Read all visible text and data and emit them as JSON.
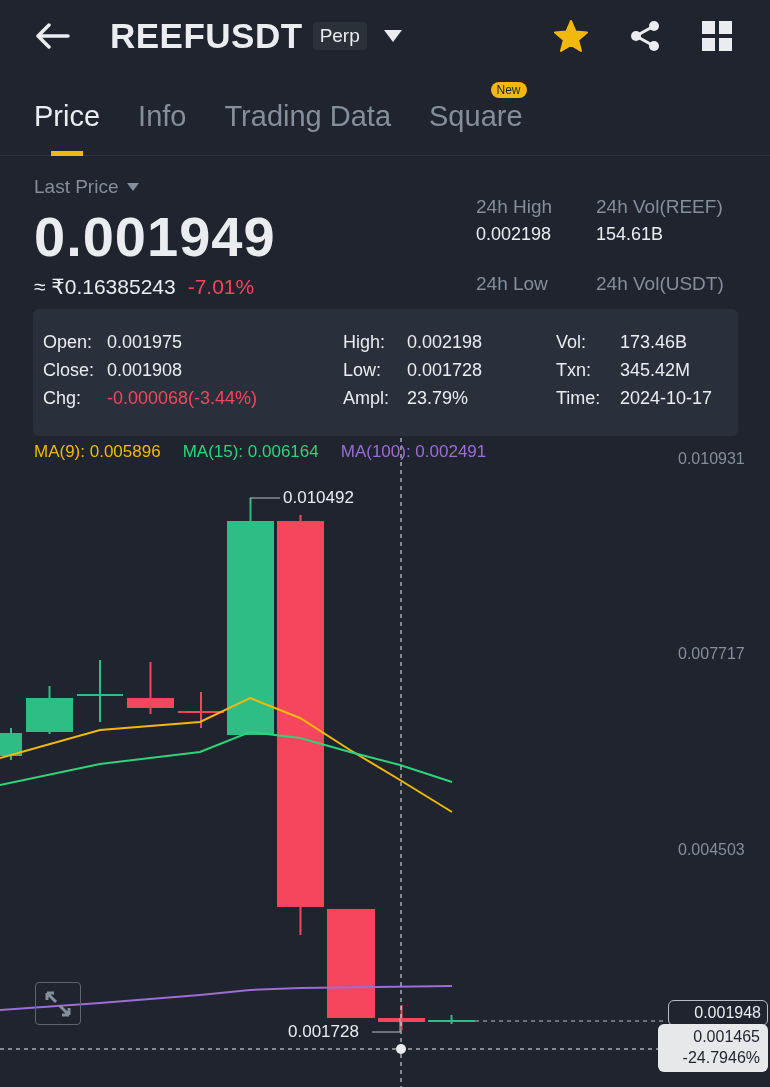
{
  "header": {
    "symbol": "REEFUSDT",
    "contract_type": "Perp",
    "favorite": true
  },
  "tabs": [
    {
      "label": "Price",
      "selected": true
    },
    {
      "label": "Info",
      "selected": false
    },
    {
      "label": "Trading Data",
      "selected": false
    },
    {
      "label": "Square",
      "selected": false,
      "badge": "New"
    }
  ],
  "last_price": {
    "label": "Last Price",
    "value": "0.001949",
    "fiat": "≈ ₹0.16385243",
    "change": "-7.01%"
  },
  "stats": [
    {
      "label": "24h High",
      "value": "0.002198"
    },
    {
      "label": "24h Vol(REEF)",
      "value": "154.61B"
    },
    {
      "label": "24h Low"
    },
    {
      "label": "24h Vol(USDT)"
    }
  ],
  "candle_info": {
    "columns": [
      [
        {
          "label": "Open:",
          "value": "0.001975",
          "negative": false
        },
        {
          "label": "Close:",
          "value": "0.001908",
          "negative": false
        },
        {
          "label": "Chg:",
          "value": "-0.000068(-3.44%)",
          "negative": true
        }
      ],
      [
        {
          "label": "High:",
          "value": "0.002198",
          "negative": false
        },
        {
          "label": "Low:",
          "value": "0.001728",
          "negative": false
        },
        {
          "label": "Ampl:",
          "value": "23.79%",
          "negative": false
        }
      ],
      [
        {
          "label": "Vol:",
          "value": "173.46B",
          "negative": false
        },
        {
          "label": "Txn:",
          "value": "345.42M",
          "negative": false
        },
        {
          "label": "Time:",
          "value": "2024-10-17",
          "negative": false
        }
      ]
    ]
  },
  "chart": {
    "moving_averages": [
      {
        "label": "MA(9): 0.005896",
        "color": "#f0b90b"
      },
      {
        "label": "MA(15): 0.006164",
        "color": "#2ed47a"
      },
      {
        "label": "MA(100): 0.002491",
        "color": "#9b6dd6"
      }
    ],
    "price_axis": [
      "0.010931",
      "0.007717",
      "0.004503"
    ],
    "high_marker": "0.010492",
    "low_marker": "0.001728",
    "last_price_tag": "0.001948",
    "crosshair": {
      "price": "0.001465",
      "change": "-24.7946%"
    }
  }
}
